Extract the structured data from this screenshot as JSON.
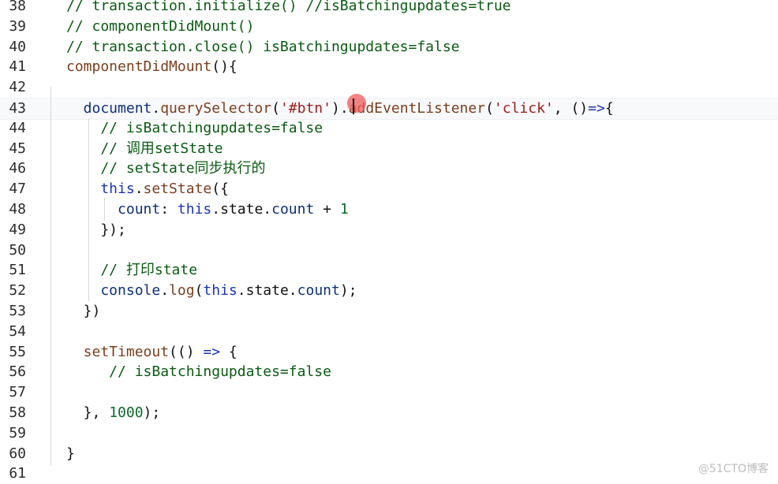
{
  "watermark": "@51CTO博客",
  "lines": [
    {
      "n": "38",
      "tokens": [
        {
          "c": "t-comment",
          "t": "// transaction.initialize() //isBatchingupdates=true"
        }
      ]
    },
    {
      "n": "39",
      "tokens": [
        {
          "c": "t-comment",
          "t": "// componentDidMount()"
        }
      ]
    },
    {
      "n": "40",
      "tokens": [
        {
          "c": "t-comment",
          "t": "// transaction.close() isBatchingupdates=false"
        }
      ]
    },
    {
      "n": "41",
      "tokens": [
        {
          "c": "t-fn",
          "t": "componentDidMount"
        },
        {
          "c": "t-punc",
          "t": "(){"
        }
      ]
    },
    {
      "n": "42",
      "tokens": []
    },
    {
      "n": "43",
      "tokens": [
        {
          "c": "t-prop",
          "t": "  document"
        },
        {
          "c": "t-punc",
          "t": "."
        },
        {
          "c": "t-fn",
          "t": "querySelector"
        },
        {
          "c": "t-punc",
          "t": "("
        },
        {
          "c": "t-str",
          "t": "'#btn'"
        },
        {
          "c": "t-punc",
          "t": ")."
        },
        {
          "c": "t-fn",
          "t": "addEventListener"
        },
        {
          "c": "t-punc",
          "t": "("
        },
        {
          "c": "t-str",
          "t": "'click'"
        },
        {
          "c": "t-punc",
          "t": ", ()"
        },
        {
          "c": "t-kw",
          "t": "=>"
        },
        {
          "c": "t-punc",
          "t": "{"
        }
      ]
    },
    {
      "n": "44",
      "tokens": [
        {
          "c": "t-comment",
          "t": "    // isBatchingupdates=false"
        }
      ]
    },
    {
      "n": "45",
      "tokens": [
        {
          "c": "t-comment",
          "t": "    // 调用setState"
        }
      ]
    },
    {
      "n": "46",
      "tokens": [
        {
          "c": "t-comment",
          "t": "    // setState同步执行的"
        }
      ]
    },
    {
      "n": "47",
      "tokens": [
        {
          "c": "t-kw",
          "t": "    this"
        },
        {
          "c": "t-punc",
          "t": "."
        },
        {
          "c": "t-fn",
          "t": "setState"
        },
        {
          "c": "t-punc",
          "t": "({"
        }
      ]
    },
    {
      "n": "48",
      "tokens": [
        {
          "c": "t-prop",
          "t": "      count"
        },
        {
          "c": "t-punc",
          "t": ": "
        },
        {
          "c": "t-kw",
          "t": "this"
        },
        {
          "c": "t-punc",
          "t": ".state."
        },
        {
          "c": "t-prop",
          "t": "count"
        },
        {
          "c": "t-punc",
          "t": " + "
        },
        {
          "c": "t-num",
          "t": "1"
        }
      ]
    },
    {
      "n": "49",
      "tokens": [
        {
          "c": "t-punc",
          "t": "    });"
        }
      ]
    },
    {
      "n": "50",
      "tokens": []
    },
    {
      "n": "51",
      "tokens": [
        {
          "c": "t-comment",
          "t": "    // 打印state"
        }
      ]
    },
    {
      "n": "52",
      "tokens": [
        {
          "c": "t-prop",
          "t": "    console"
        },
        {
          "c": "t-punc",
          "t": "."
        },
        {
          "c": "t-fn",
          "t": "log"
        },
        {
          "c": "t-punc",
          "t": "("
        },
        {
          "c": "t-kw",
          "t": "this"
        },
        {
          "c": "t-punc",
          "t": ".state."
        },
        {
          "c": "t-prop",
          "t": "count"
        },
        {
          "c": "t-punc",
          "t": ");"
        }
      ]
    },
    {
      "n": "53",
      "tokens": [
        {
          "c": "t-punc",
          "t": "  })"
        }
      ]
    },
    {
      "n": "54",
      "tokens": []
    },
    {
      "n": "55",
      "tokens": [
        {
          "c": "t-fn",
          "t": "  setTimeout"
        },
        {
          "c": "t-punc",
          "t": "(() "
        },
        {
          "c": "t-kw",
          "t": "=>"
        },
        {
          "c": "t-punc",
          "t": " {"
        }
      ]
    },
    {
      "n": "56",
      "tokens": [
        {
          "c": "t-comment",
          "t": "     // isBatchingupdates=false"
        }
      ]
    },
    {
      "n": "57",
      "tokens": []
    },
    {
      "n": "58",
      "tokens": [
        {
          "c": "t-punc",
          "t": "  }, "
        },
        {
          "c": "t-num",
          "t": "1000"
        },
        {
          "c": "t-punc",
          "t": ");"
        }
      ]
    },
    {
      "n": "59",
      "tokens": []
    },
    {
      "n": "60",
      "tokens": [
        {
          "c": "t-punc",
          "t": "}"
        }
      ]
    },
    {
      "n": "61",
      "tokens": []
    }
  ]
}
